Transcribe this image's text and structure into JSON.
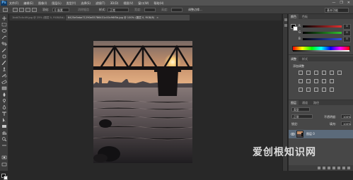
{
  "app": {
    "logo": "Ps"
  },
  "menu": {
    "items": [
      "文件(F)",
      "编辑(E)",
      "图像(I)",
      "图层(L)",
      "类型(Y)",
      "选择(S)",
      "滤镜(T)",
      "3D(D)",
      "视图(V)",
      "窗口(W)",
      "帮助(H)"
    ]
  },
  "window_controls": {
    "minimize": "—",
    "restore": "❐",
    "close": "✕"
  },
  "options": {
    "feather_label": "羽化:",
    "feather_value": "0 像素",
    "antialias_label": "消除锯齿",
    "style_label": "样式:",
    "style_value": "正常",
    "width_label": "宽度:",
    "height_label": "高度:",
    "refine_label": "调整边缘...",
    "workspace": "基本功能"
  },
  "tabs": [
    {
      "label": "1bd47c4c49.jpg @ 25% (图层 0, RGB/8#)",
      "close": "×"
    },
    {
      "label": "8425e5ebe71290e55786431c00c96f5b.jpg @ 100% (图层 0, RGB/8)",
      "close": "×"
    }
  ],
  "color_panel": {
    "tabs": [
      "颜色",
      "色板"
    ],
    "sliders": [
      {
        "label": "R",
        "value": "0",
        "color": "#e03030"
      },
      {
        "label": "G",
        "value": "0",
        "color": "#30c030"
      },
      {
        "label": "B",
        "value": "0",
        "color": "#3050e0"
      }
    ]
  },
  "adjustments_panel": {
    "tabs": [
      "调整",
      "样式"
    ],
    "title": "添加调整"
  },
  "layers_panel": {
    "tabs": [
      "图层",
      "通道",
      "路径"
    ],
    "filter_label": "类型",
    "blend_mode": "正常",
    "opacity_label": "不透明度:",
    "opacity_value": "100%",
    "lock_label": "锁定:",
    "fill_label": "填充:",
    "fill_value": "100%",
    "layer_name": "图层 0"
  },
  "watermark": "爱创根知识网"
}
